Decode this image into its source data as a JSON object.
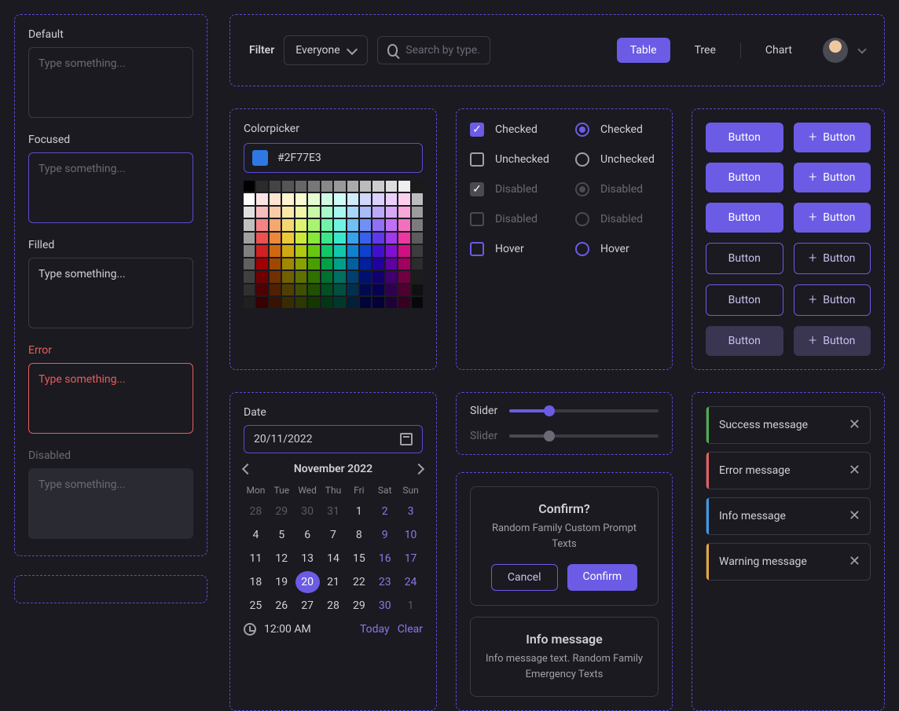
{
  "textareas": {
    "default": {
      "label": "Default",
      "placeholder": "Type something..."
    },
    "focused": {
      "label": "Focused",
      "placeholder": "Type something..."
    },
    "filled": {
      "label": "Filled",
      "value": "Type something..."
    },
    "error": {
      "label": "Error",
      "placeholder": "Type something..."
    },
    "disabled": {
      "label": "Disabled",
      "placeholder": "Type something..."
    }
  },
  "topbar": {
    "filter_label": "Filter",
    "filter_value": "Everyone",
    "search_placeholder": "Search by type...",
    "tabs": {
      "table": "Table",
      "tree": "Tree",
      "chart": "Chart"
    }
  },
  "colorpicker": {
    "title": "Colorpicker",
    "value": "#2F77E3",
    "swatch": "#2F77E3",
    "colors": [
      "#000000",
      "#2b2b2b",
      "#444",
      "#555",
      "#666",
      "#777",
      "#888",
      "#999",
      "#aaa",
      "#bbb",
      "#ccc",
      "#ddd",
      "#eee",
      "#1a1a1a",
      "#ffffff",
      "#fde4e4",
      "#fde4d0",
      "#fdf4d0",
      "#f8fcd0",
      "#e4fcd0",
      "#d0fce4",
      "#d0fcf8",
      "#d0ecfc",
      "#d0d8fc",
      "#dcd0fc",
      "#ecd0fc",
      "#fcd0ec",
      "#bcbcbc",
      "#e0e0e0",
      "#f9bcbc",
      "#f9cca8",
      "#f9e8a8",
      "#eef8a8",
      "#c8f8a8",
      "#a8f8cc",
      "#a8f8ee",
      "#a8d8f8",
      "#a8bcf8",
      "#bca8f8",
      "#d8a8f8",
      "#f8a8d8",
      "#9c9c9c",
      "#c0c0c0",
      "#f38484",
      "#f3a870",
      "#f3d870",
      "#e0f370",
      "#a8f370",
      "#70f3a8",
      "#70f3e0",
      "#70c0f3",
      "#7090f3",
      "#9070f3",
      "#c070f3",
      "#f370c0",
      "#7c7c7c",
      "#a0a0a0",
      "#ec5050",
      "#ec8838",
      "#ecc838",
      "#cce838",
      "#88e838",
      "#38e888",
      "#38e8cc",
      "#38a0ec",
      "#3860ec",
      "#6038ec",
      "#a038ec",
      "#ec38a0",
      "#5c5c5c",
      "#808080",
      "#d02020",
      "#d06810",
      "#d0a810",
      "#b0c810",
      "#68c810",
      "#10c868",
      "#10c8b0",
      "#1080d0",
      "#1040d0",
      "#4010d0",
      "#8010d0",
      "#d01080",
      "#3c3c3c",
      "#606060",
      "#a00000",
      "#a04800",
      "#a08800",
      "#88a000",
      "#48a000",
      "#00a048",
      "#00a088",
      "#0060a0",
      "#0020a0",
      "#2000a0",
      "#6000a0",
      "#a00060",
      "#2c2c2c",
      "#404040",
      "#700000",
      "#703000",
      "#706000",
      "#607000",
      "#307000",
      "#007030",
      "#007060",
      "#004070",
      "#001070",
      "#100070",
      "#400070",
      "#700040",
      "#1c1c1c",
      "#303030",
      "#500000",
      "#502000",
      "#504000",
      "#405000",
      "#205000",
      "#005020",
      "#005040",
      "#003050",
      "#000850",
      "#080050",
      "#300050",
      "#500030",
      "#101010",
      "#202020",
      "#380000",
      "#381400",
      "#382c00",
      "#2c3800",
      "#143800",
      "#003814",
      "#00382c",
      "#002038",
      "#000438",
      "#040038",
      "#200038",
      "#380020",
      "#080808"
    ]
  },
  "checks": {
    "checked": "Checked",
    "unchecked": "Unchecked",
    "disabled": "Disabled",
    "hover": "Hover"
  },
  "buttons": {
    "label": "Button"
  },
  "sliders": {
    "label": "Slider",
    "value1": 27,
    "value2": 27
  },
  "date": {
    "title": "Date",
    "value": "20/11/2022",
    "month": "November 2022",
    "dow": [
      "Mon",
      "Tue",
      "Wed",
      "Thu",
      "Fri",
      "Sat",
      "Sun"
    ],
    "grid": [
      {
        "d": "28",
        "o": 1
      },
      {
        "d": "29",
        "o": 1
      },
      {
        "d": "30",
        "o": 1
      },
      {
        "d": "31",
        "o": 1
      },
      {
        "d": "1"
      },
      {
        "d": "2",
        "w": 1
      },
      {
        "d": "3",
        "w": 1
      },
      {
        "d": "4"
      },
      {
        "d": "5"
      },
      {
        "d": "6"
      },
      {
        "d": "7"
      },
      {
        "d": "8"
      },
      {
        "d": "9",
        "w": 1
      },
      {
        "d": "10",
        "w": 1
      },
      {
        "d": "11"
      },
      {
        "d": "12"
      },
      {
        "d": "13"
      },
      {
        "d": "14"
      },
      {
        "d": "15"
      },
      {
        "d": "16",
        "w": 1
      },
      {
        "d": "17",
        "w": 1
      },
      {
        "d": "18"
      },
      {
        "d": "19"
      },
      {
        "d": "20",
        "s": 1
      },
      {
        "d": "21"
      },
      {
        "d": "22"
      },
      {
        "d": "23",
        "w": 1
      },
      {
        "d": "24",
        "w": 1
      },
      {
        "d": "25"
      },
      {
        "d": "26"
      },
      {
        "d": "27"
      },
      {
        "d": "28"
      },
      {
        "d": "29"
      },
      {
        "d": "30",
        "w": 1
      },
      {
        "d": "1",
        "o": 1
      }
    ],
    "time": "12:00 AM",
    "today": "Today",
    "clear": "Clear"
  },
  "modal": {
    "title": "Confirm?",
    "body": "Random Family Custom Prompt Texts",
    "cancel": "Cancel",
    "confirm": "Confirm"
  },
  "info": {
    "title": "Info message",
    "body": "Info message text. Random Family Emergency Texts"
  },
  "alerts": {
    "success": "Success message",
    "error": "Error message",
    "info": "Info message",
    "warning": "Warning message"
  }
}
